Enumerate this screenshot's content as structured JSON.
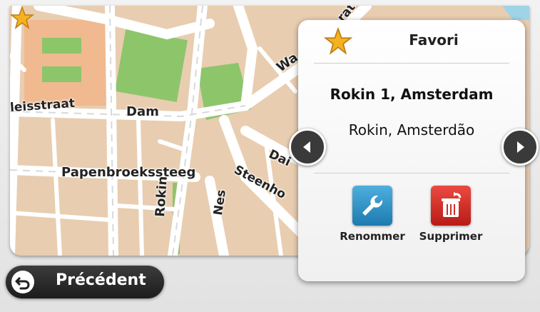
{
  "map": {
    "streets": [
      "leisstraat",
      "Dam",
      "Papenbroekssteeg",
      "Rokin",
      "Nes",
      "Steenho",
      "Wa",
      "Dai",
      "rat"
    ]
  },
  "panel": {
    "title": "Favori",
    "address_primary": "Rokin 1, Amsterdam",
    "address_secondary": "Rokin, Amsterdão",
    "icons": {
      "title": "star-icon",
      "prev": "chevron-left-icon",
      "next": "chevron-right-icon"
    },
    "actions": [
      {
        "label": "Renommer",
        "icon": "wrench-icon",
        "color": "#2a8fc4"
      },
      {
        "label": "Supprimer",
        "icon": "trash-icon",
        "color": "#d52a24"
      }
    ]
  },
  "back_button": {
    "label": "Précédent",
    "icon": "back-arrow-icon"
  },
  "colors": {
    "map_land": "#e8cdb0",
    "park": "#8dc56b",
    "road": "#ffffff",
    "star": "#f4b223"
  }
}
